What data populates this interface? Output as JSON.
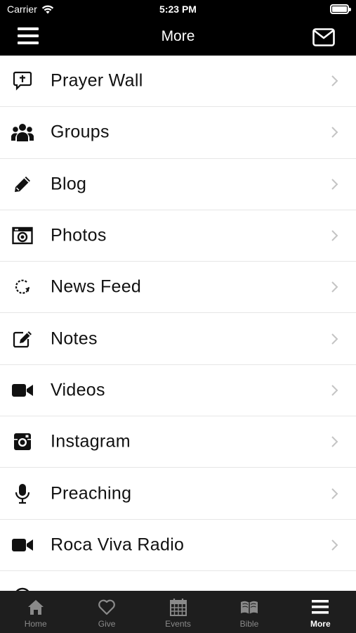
{
  "status_bar": {
    "carrier": "Carrier",
    "time": "5:23 PM"
  },
  "nav": {
    "title": "More"
  },
  "menu": {
    "items": [
      {
        "label": "Prayer Wall",
        "icon": "prayer-bubble-icon"
      },
      {
        "label": "Groups",
        "icon": "groups-icon"
      },
      {
        "label": "Blog",
        "icon": "pencil-icon"
      },
      {
        "label": "Photos",
        "icon": "camera-icon"
      },
      {
        "label": "News Feed",
        "icon": "refresh-icon"
      },
      {
        "label": "Notes",
        "icon": "edit-note-icon"
      },
      {
        "label": "Videos",
        "icon": "video-camera-icon"
      },
      {
        "label": "Instagram",
        "icon": "instagram-icon"
      },
      {
        "label": "Preaching",
        "icon": "microphone-icon"
      },
      {
        "label": "Roca Viva Radio",
        "icon": "video-camera-icon"
      },
      {
        "label": "",
        "icon": "info-icon"
      }
    ]
  },
  "tabs": [
    {
      "label": "Home",
      "icon": "home-icon",
      "active": false
    },
    {
      "label": "Give",
      "icon": "heart-icon",
      "active": false
    },
    {
      "label": "Events",
      "icon": "calendar-icon",
      "active": false
    },
    {
      "label": "Bible",
      "icon": "book-icon",
      "active": false
    },
    {
      "label": "More",
      "icon": "menu-icon",
      "active": true
    }
  ],
  "colors": {
    "bar_background": "#000000",
    "tab_background": "#1e1e1e",
    "tab_inactive": "#8a8a8a",
    "tab_active": "#ffffff"
  }
}
